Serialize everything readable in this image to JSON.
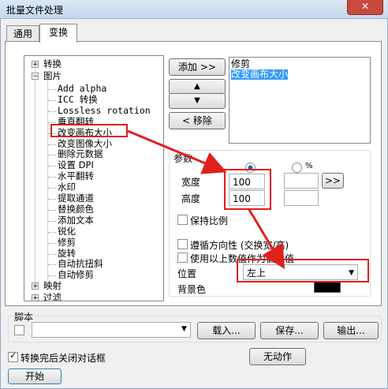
{
  "window": {
    "title": "批量文件处理",
    "close": "✕"
  },
  "tabs": [
    {
      "label": "通用"
    },
    {
      "label": "变换"
    }
  ],
  "tree": {
    "root1": "转换",
    "root2": "图片",
    "children": [
      "Add alpha",
      "ICC 转换",
      "Lossless rotation",
      "垂直翻转",
      "改变画布大小",
      "改变图像大小",
      "删除元数据",
      "设置 DPI",
      "水平翻转",
      "水印",
      "提取通道",
      "替换颜色",
      "添加文本",
      "锐化",
      "修剪",
      "旋转",
      "自动抗扭斜",
      "自动修剪"
    ],
    "root3": "映射",
    "root4": "过滤"
  },
  "buttons": {
    "add": "添加 >>",
    "up": "▲",
    "down": "▼",
    "remove": "< 移除",
    "percent_arrow": ">>",
    "load": "载入...",
    "save": "保存...",
    "output": "输出...",
    "no_action": "无动作",
    "start": "开始"
  },
  "operations": [
    "修剪",
    "改变画布大小"
  ],
  "params": {
    "title": "参数",
    "percent_label": "%",
    "width_label": "宽度",
    "width_value": "100",
    "height_label": "高度",
    "height_value": "100",
    "keep_ratio": "保持比例",
    "follow_dir": "遵循方向性 (交换宽/高)",
    "use_above": "使用以上数值作为偏移值",
    "position_label": "位置",
    "position_value": "左上",
    "bg_label": "背景色",
    "bg_color": "#000000"
  },
  "script": {
    "label": "脚本",
    "value": ""
  },
  "close_dialog": "转换完后关闭对话框",
  "colors": {
    "highlight": "#3399ff",
    "annotation": "#e0201d"
  }
}
